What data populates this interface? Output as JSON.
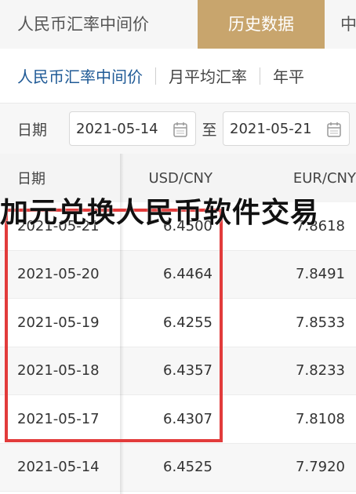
{
  "top_tabs": [
    {
      "label": "人民币汇率中间价"
    },
    {
      "label": "历史数据"
    },
    {
      "label": "中"
    }
  ],
  "sub_tabs": [
    {
      "label": "人民币汇率中间价"
    },
    {
      "label": "月平均汇率"
    },
    {
      "label": "年平"
    }
  ],
  "date_filter": {
    "label": "日期",
    "start": "2021-05-14",
    "to_label": "至",
    "end": "2021-05-21"
  },
  "table": {
    "headers": [
      "日期",
      "USD/CNY",
      "EUR/CNY"
    ],
    "rows": [
      {
        "date": "2021-05-21",
        "usd": "6.4500",
        "eur": "7.8618"
      },
      {
        "date": "2021-05-20",
        "usd": "6.4464",
        "eur": "7.8491"
      },
      {
        "date": "2021-05-19",
        "usd": "6.4255",
        "eur": "7.8533"
      },
      {
        "date": "2021-05-18",
        "usd": "6.4357",
        "eur": "7.8233"
      },
      {
        "date": "2021-05-17",
        "usd": "6.4307",
        "eur": "7.8108"
      },
      {
        "date": "2021-05-14",
        "usd": "6.4525",
        "eur": "7.7920"
      }
    ]
  },
  "overlay_caption": "加元兑换人民币软件交易",
  "colors": {
    "accent_gold": "#c8a56d",
    "link_blue": "#1f5a96",
    "highlight_red": "#e23b3b"
  }
}
